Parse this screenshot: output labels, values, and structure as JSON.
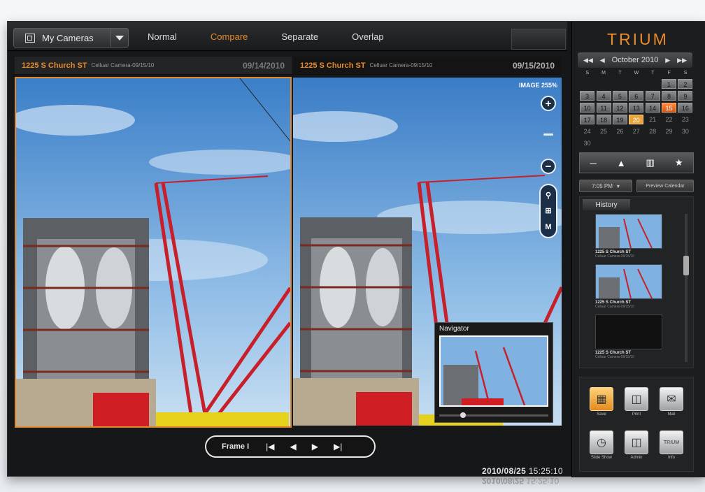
{
  "topbar": {
    "camera_select_label": "My Cameras",
    "modes": [
      "Normal",
      "Compare",
      "Separate",
      "Overlap"
    ],
    "active_mode": "Compare"
  },
  "left_pane": {
    "location": "1225 S Church ST",
    "camera": "Celluar Camera-09/15/10",
    "date": "09/14/2010"
  },
  "right_pane": {
    "location": "1225 S Church ST",
    "camera": "Celluar Camera-09/15/10",
    "date": "09/15/2010",
    "zoom_label": "IMAGE 255%",
    "navigator_title": "Navigator",
    "navigator_position": 0.2
  },
  "frame_control": {
    "label": "Frame I"
  },
  "timestamp": {
    "date": "2010/08/25",
    "time": "15:25:10"
  },
  "sidebar": {
    "logo": "TRIUM",
    "calendar": {
      "month_label": "October 2010",
      "weekdays": [
        "S",
        "M",
        "T",
        "W",
        "T",
        "F",
        "S"
      ],
      "weeks": [
        [
          "",
          "",
          "",
          "",
          "",
          "1",
          "2"
        ],
        [
          "3",
          "4",
          "5",
          "6",
          "7",
          "8",
          "9"
        ],
        [
          "10",
          "11",
          "12",
          "13",
          "14",
          "15",
          "16"
        ],
        [
          "17",
          "18",
          "19",
          "20",
          "21",
          "22",
          "23"
        ],
        [
          "24",
          "25",
          "26",
          "27",
          "28",
          "29",
          "30"
        ],
        [
          "30",
          "",
          "",
          "",
          "",
          "",
          ""
        ]
      ],
      "selected_day": "15",
      "highlight_day": "20"
    },
    "time_select": "7:05 PM",
    "preview_button": "Preview Calendar",
    "history_tab": "History",
    "history_items": [
      {
        "location": "1225 S Church ST",
        "camera": "Celluar Camera-09/15/10"
      },
      {
        "location": "1225 S Church ST",
        "camera": "Celluar Camera-09/15/10"
      },
      {
        "location": "1225 S Church ST",
        "camera": "Celluar Camera-09/15/10"
      }
    ],
    "actions": [
      {
        "label": "Save"
      },
      {
        "label": "Print"
      },
      {
        "label": "Mail"
      },
      {
        "label": "Slide Show"
      },
      {
        "label": "Admin"
      },
      {
        "label": "Info"
      }
    ]
  }
}
